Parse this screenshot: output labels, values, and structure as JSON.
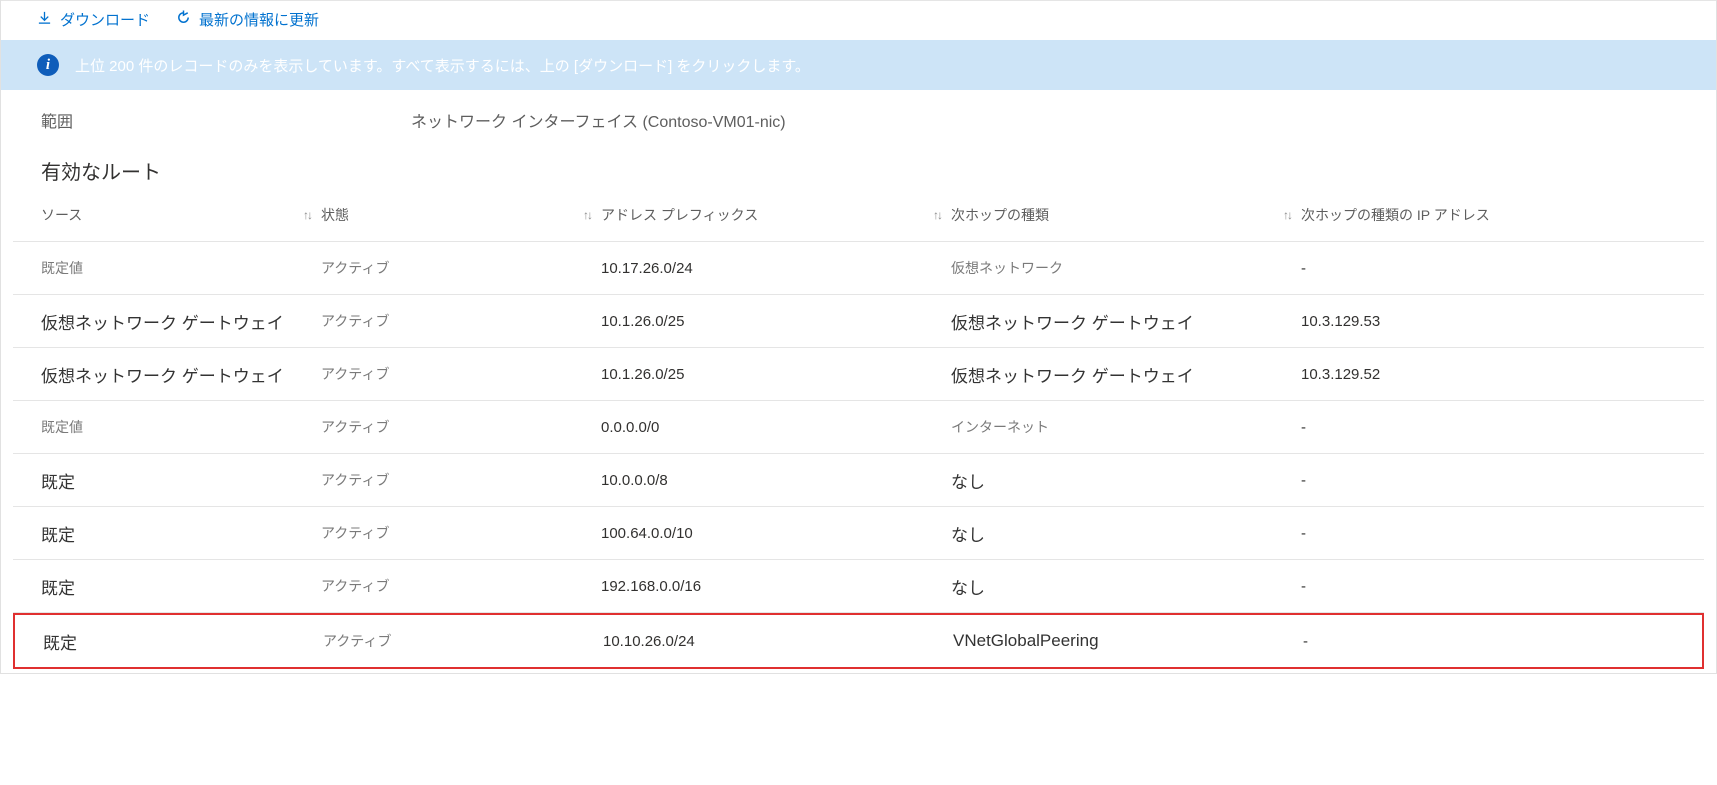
{
  "toolbar": {
    "download_label": "ダウンロード",
    "refresh_label": "最新の情報に更新"
  },
  "banner": {
    "text": "上位 200 件のレコードのみを表示しています。すべて表示するには、上の [ダウンロード] をクリックします。"
  },
  "properties": {
    "scope_label": "範囲",
    "scope_value": "ネットワーク インターフェイス (Contoso-VM01-nic)"
  },
  "section": {
    "title": "有効なルート"
  },
  "table": {
    "columns": {
      "source": "ソース",
      "state": "状態",
      "prefix": "アドレス プレフィックス",
      "hop_type": "次ホップの種類",
      "hop_ip": "次ホップの種類の IP アドレス"
    },
    "rows": [
      {
        "source": "既定値",
        "source_small": true,
        "state": "アクティブ",
        "prefix": "10.17.26.0/24",
        "hop_type": "仮想ネットワーク",
        "hop_type_small": true,
        "hop_ip": "-"
      },
      {
        "source": "仮想ネットワーク ゲートウェイ",
        "source_small": false,
        "state": "アクティブ",
        "prefix": "10.1.26.0/25",
        "hop_type": "仮想ネットワーク ゲートウェイ",
        "hop_type_small": false,
        "hop_ip": "10.3.129.53"
      },
      {
        "source": "仮想ネットワーク ゲートウェイ",
        "source_small": false,
        "state": "アクティブ",
        "prefix": "10.1.26.0/25",
        "hop_type": "仮想ネットワーク ゲートウェイ",
        "hop_type_small": false,
        "hop_ip": "10.3.129.52"
      },
      {
        "source": "既定値",
        "source_small": true,
        "state": "アクティブ",
        "prefix": "0.0.0.0/0",
        "hop_type": "インターネット",
        "hop_type_small": true,
        "hop_ip": "-"
      },
      {
        "source": "既定",
        "source_small": false,
        "state": "アクティブ",
        "prefix": "10.0.0.0/8",
        "hop_type": "なし",
        "hop_type_small": false,
        "hop_ip": "-"
      },
      {
        "source": "既定",
        "source_small": false,
        "state": "アクティブ",
        "prefix": "100.64.0.0/10",
        "hop_type": "なし",
        "hop_type_small": false,
        "hop_ip": "-"
      },
      {
        "source": "既定",
        "source_small": false,
        "state": "アクティブ",
        "prefix": "192.168.0.0/16",
        "hop_type": "なし",
        "hop_type_small": false,
        "hop_ip": "-"
      },
      {
        "source": "既定",
        "source_small": false,
        "state": "アクティブ",
        "prefix": "10.10.26.0/24",
        "hop_type": "VNetGlobalPeering",
        "hop_type_small": false,
        "hop_ip": "-",
        "highlight": true
      }
    ]
  }
}
